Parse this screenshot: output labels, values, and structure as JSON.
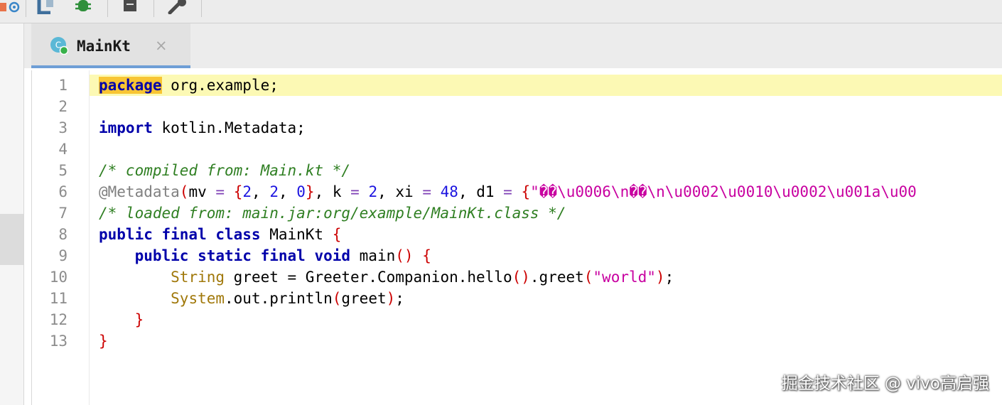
{
  "tab": {
    "title": "MainKt",
    "close_glyph": "×",
    "icon_letter": "C"
  },
  "colors": {
    "tab_active_underline": "#6e9ed6",
    "current_line": "#fcf9b4",
    "keyword": "#0000aa",
    "comment": "#2f7f22",
    "string_magenta": "#c800a0",
    "type": "#a0780a",
    "brace": "#cc0000"
  },
  "editor": {
    "line_numbers": [
      "1",
      "2",
      "3",
      "4",
      "5",
      "6",
      "7",
      "8",
      "9",
      "10",
      "11",
      "12",
      "13"
    ],
    "code": {
      "l1": {
        "kw": "package",
        "rest": " org.example;"
      },
      "l3": {
        "kw": "import",
        "rest": " kotlin.Metadata;"
      },
      "l5": {
        "comment": "/* compiled from: Main.kt */"
      },
      "l6": {
        "ann": "@Metadata",
        "p_open": "(",
        "t1": "mv ",
        "eq1": "=",
        "sp1": " ",
        "b_open": "{",
        "n1": "2",
        "c1": ", ",
        "n2": "2",
        "c2": ", ",
        "n3": "0",
        "b_close": "}",
        "t2": ", k ",
        "eq2": "=",
        "sp2": " ",
        "n4": "2",
        "t3": ", xi ",
        "eq3": "=",
        "sp3": " ",
        "n5": "48",
        "t4": ", d1 ",
        "eq4": "=",
        "sp4": " ",
        "b2_open": "{",
        "s1": "\"��\\u0006\\n��\\n\\u0002\\u0010\\u0002\\u001a\\u00"
      },
      "l7": {
        "comment": "/* loaded from: main.jar:org/example/MainKt.class */"
      },
      "l8": {
        "kw": "public final class",
        "name": " MainKt ",
        "brace": "{"
      },
      "l9": {
        "indent": "    ",
        "kw": "public static final void",
        "name": " main",
        "p": "()",
        "sp": " ",
        "brace": "{"
      },
      "l10": {
        "indent": "        ",
        "type": "String",
        "rest1": " greet = Greeter.Companion.hello",
        "p1": "()",
        "rest2": ".greet",
        "p_open": "(",
        "str": "\"world\"",
        "p_close": ")",
        "end": ";"
      },
      "l11": {
        "indent": "        ",
        "type": "System",
        "rest1": ".out.println",
        "p_open": "(",
        "arg": "greet",
        "p_close": ")",
        "end": ";"
      },
      "l12": {
        "indent": "    ",
        "brace": "}"
      },
      "l13": {
        "brace": "}"
      }
    }
  },
  "watermark": "掘金技术社区 @ vivo高启强"
}
